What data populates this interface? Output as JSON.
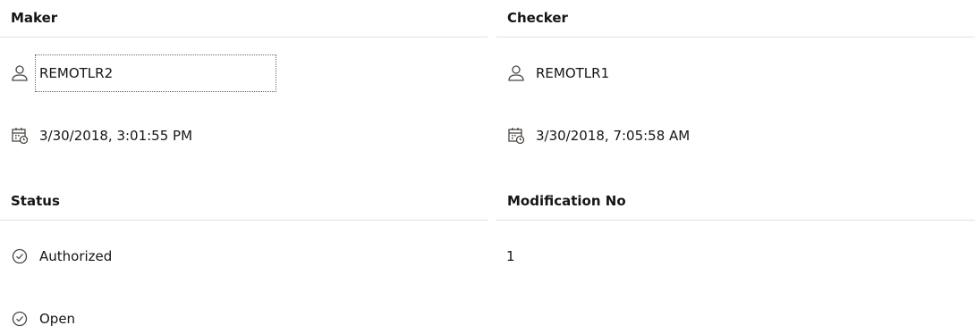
{
  "maker": {
    "title": "Maker",
    "user": "REMOTLR2",
    "timestamp": "3/30/2018, 3:01:55 PM",
    "user_icon": "user-icon",
    "date_icon": "calendar-clock-icon"
  },
  "checker": {
    "title": "Checker",
    "user": "REMOTLR1",
    "timestamp": "3/30/2018, 7:05:58 AM",
    "user_icon": "user-icon",
    "date_icon": "calendar-clock-icon"
  },
  "status": {
    "title": "Status",
    "items": [
      {
        "label": "Authorized",
        "icon": "check-circle-icon"
      },
      {
        "label": "Open",
        "icon": "check-circle-icon"
      }
    ]
  },
  "modification": {
    "title": "Modification No",
    "value": "1"
  }
}
